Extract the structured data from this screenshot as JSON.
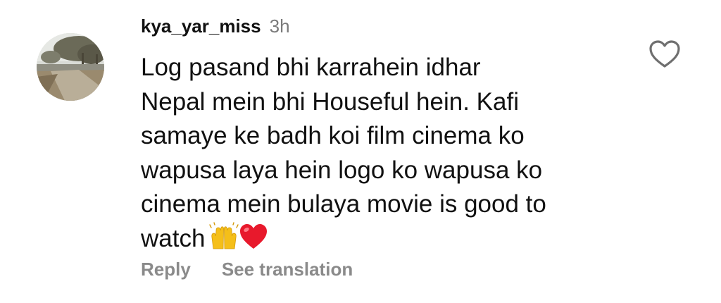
{
  "comment": {
    "author": {
      "username": "kya_yar_miss",
      "timestamp": "3h",
      "avatar_icon": "avatar-photo-park-road-trees"
    },
    "text_lines": [
      "Log pasand bhi karrahein idhar",
      "Nepal mein bhi Houseful hein. Kafi",
      "samaye ke badh koi film cinema ko",
      "wapusa laya hein logo ko wapusa ko",
      "cinema mein bulaya movie is good to",
      "watch"
    ],
    "emojis": [
      "raising-hands-icon",
      "red-heart-icon"
    ],
    "actions": {
      "reply_label": "Reply",
      "translate_label": "See translation"
    },
    "like_icon": "heart-outline-icon",
    "colors": {
      "text": "#111111",
      "muted": "#8a8a8a",
      "timestamp": "#7a7a7a",
      "heart": "#e8192c",
      "raise_hands": "#f5bf19"
    }
  }
}
